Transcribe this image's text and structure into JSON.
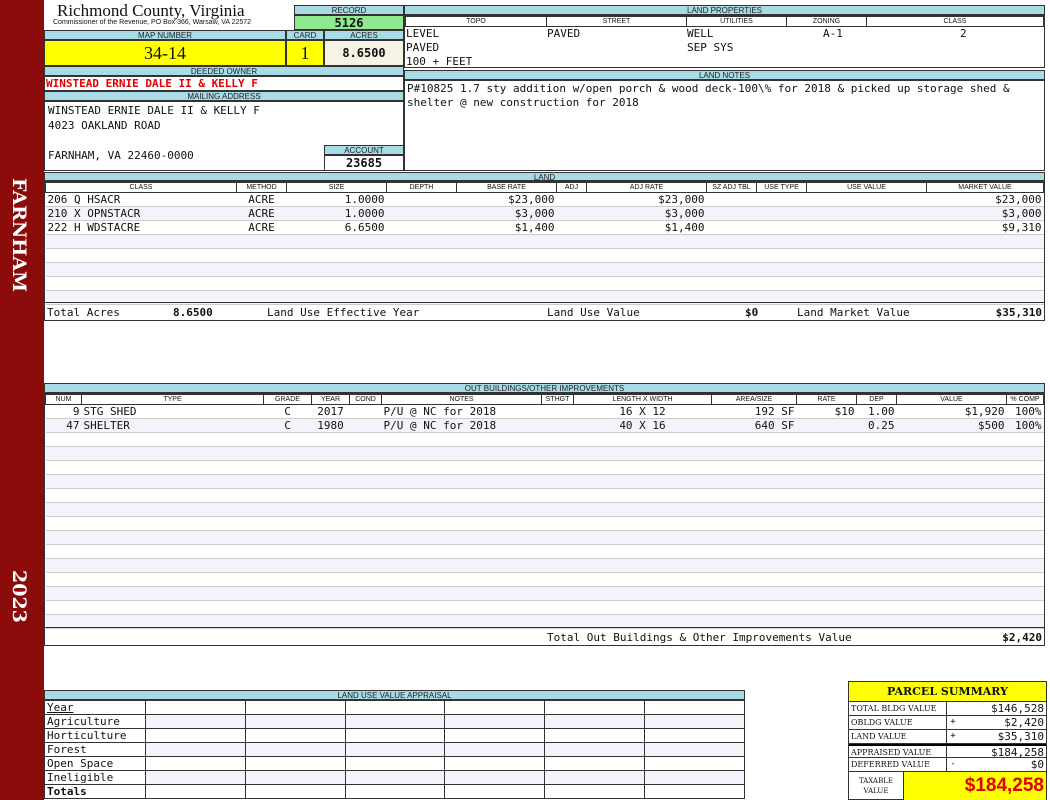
{
  "sidebar": {
    "location": "FARNHAM",
    "year": "2023"
  },
  "header": {
    "title": "Richmond County, Virginia",
    "subtitle": "Commissioner of the Revenue, PO Box 366, Warsaw, VA 22572"
  },
  "record": {
    "label": "RECORD",
    "value": "5126"
  },
  "map": {
    "label": "MAP NUMBER",
    "value": "34-14"
  },
  "card": {
    "label": "CARD",
    "value": "1"
  },
  "acres": {
    "label": "ACRES",
    "value": "8.6500"
  },
  "owner": {
    "label": "DEEDED OWNER",
    "value": "WINSTEAD ERNIE DALE II & KELLY F"
  },
  "mailing": {
    "label": "MAILING ADDRESS",
    "lines": [
      "WINSTEAD ERNIE DALE II & KELLY F",
      "4023 OAKLAND ROAD",
      "FARNHAM, VA 22460-0000"
    ]
  },
  "account": {
    "label": "ACCOUNT",
    "value": "23685"
  },
  "land_properties": {
    "label": "LAND PROPERTIES",
    "headers": [
      "TOPO",
      "STREET",
      "UTILITIES",
      "ZONING",
      "CLASS"
    ],
    "topo": [
      "LEVEL",
      "PAVED",
      "100 + FEET"
    ],
    "street": "PAVED",
    "utilities": [
      "WELL",
      "SEP SYS"
    ],
    "zoning": "A-1",
    "class": "2"
  },
  "land_notes": {
    "label": "LAND NOTES",
    "text": "P#10825 1.7 sty addition w/open porch & wood deck-100\\% for 2018 & picked up storage shed & shelter @ new construction for 2018"
  },
  "land": {
    "label": "LAND",
    "headers": [
      "CLASS",
      "METHOD",
      "SIZE",
      "DEPTH",
      "BASE RATE",
      "ADJ",
      "ADJ RATE",
      "SZ ADJ TBL",
      "USE TYPE",
      "USE VALUE",
      "MARKET VALUE"
    ],
    "rows": [
      [
        "206 Q HSACR",
        "ACRE",
        "1.0000",
        "",
        "$23,000",
        "",
        "$23,000",
        "",
        "",
        "",
        "$23,000"
      ],
      [
        "210 X OPNSTACR",
        "ACRE",
        "1.0000",
        "",
        "$3,000",
        "",
        "$3,000",
        "",
        "",
        "",
        "$3,000"
      ],
      [
        "222 H WDSTACRE",
        "ACRE",
        "6.6500",
        "",
        "$1,400",
        "",
        "$1,400",
        "",
        "",
        "",
        "$9,310"
      ]
    ],
    "totals": {
      "acres_label": "Total Acres",
      "acres": "8.6500",
      "eff_year_label": "Land Use Effective Year",
      "use_value_label": "Land Use Value",
      "use_value": "$0",
      "market_label": "Land Market Value",
      "market": "$35,310"
    }
  },
  "outbuildings": {
    "label": "OUT BUILDINGS/OTHER IMPROVEMENTS",
    "headers": [
      "NUM",
      "TYPE",
      "GRADE",
      "YEAR",
      "COND",
      "NOTES",
      "STHGT",
      "LENGTH X WIDTH",
      "AREA/SIZE",
      "RATE",
      "DEP",
      "VALUE",
      "% COMP"
    ],
    "rows": [
      [
        "9",
        "STG SHED",
        "C",
        "2017",
        "",
        "P/U @ NC for 2018",
        "",
        "16 X 12",
        "192 SF",
        "$10",
        "1.00",
        "$1,920",
        "100%"
      ],
      [
        "47",
        "SHELTER",
        "C",
        "1980",
        "",
        "P/U @ NC for 2018",
        "",
        "40 X 16",
        "640 SF",
        "",
        "0.25",
        "$500",
        "100%"
      ]
    ],
    "total_label": "Total Out Buildings & Other Improvements Value",
    "total": "$2,420"
  },
  "land_use_appraisal": {
    "label": "LAND USE VALUE APPRAISAL",
    "rows": [
      "Year",
      "Agriculture",
      "Horticulture",
      "Forest",
      "Open Space",
      "Ineligible",
      "Totals"
    ]
  },
  "parcel_summary": {
    "title": "PARCEL SUMMARY",
    "rows": [
      {
        "label": "TOTAL BLDG VALUE",
        "sign": "",
        "value": "$146,528"
      },
      {
        "label": "OBLDG VALUE",
        "sign": "+",
        "value": "$2,420"
      },
      {
        "label": "LAND VALUE",
        "sign": "+",
        "value": "$35,310"
      },
      {
        "label": "APPRAISED VALUE",
        "sign": "",
        "value": "$184,258"
      },
      {
        "label": "DEFERRED VALUE",
        "sign": "-",
        "value": "$0"
      }
    ],
    "taxable_label": "TAXABLE VALUE",
    "taxable": "$184,258"
  },
  "colors": {
    "sidebar": "#8b0a0a",
    "label_bar": "#a9dbe6",
    "highlight": "#ffff00",
    "record": "#90e890",
    "owner_text": "#e00000"
  }
}
